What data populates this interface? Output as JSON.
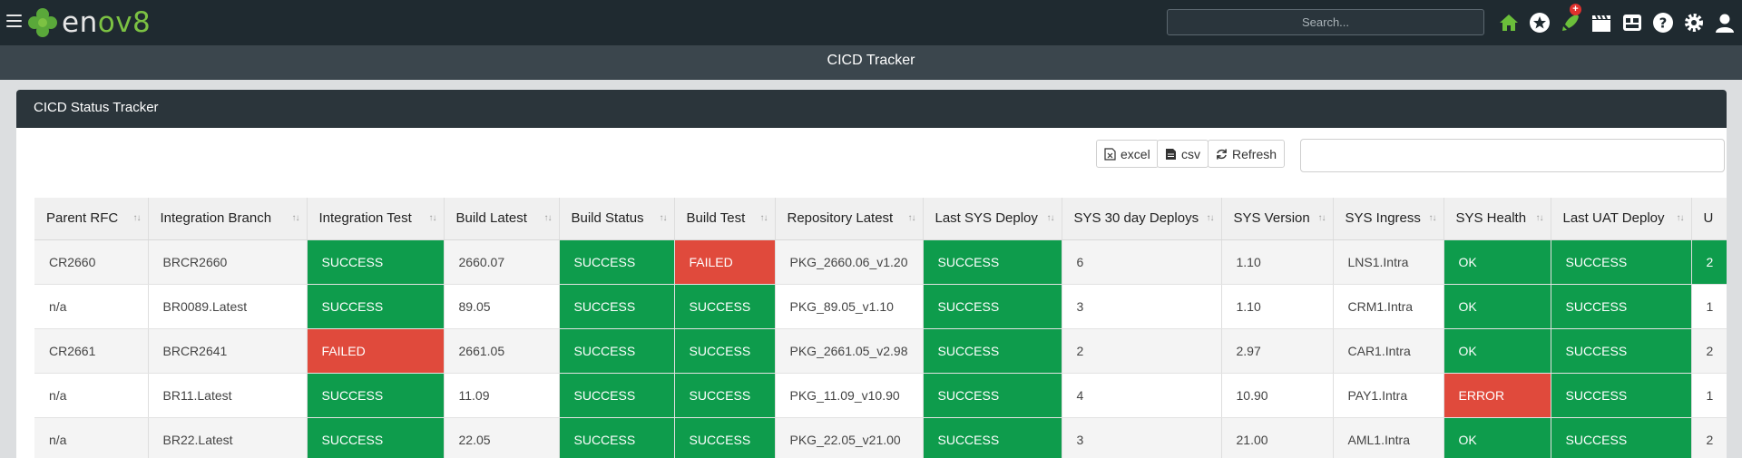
{
  "app": {
    "brand_prefix": "en",
    "brand_accent": "ov8"
  },
  "header": {
    "search_placeholder": "Search...",
    "badge_count": "+"
  },
  "page": {
    "title": "CICD Tracker"
  },
  "panel": {
    "title": "CICD Status Tracker"
  },
  "toolbar": {
    "excel_label": "excel",
    "csv_label": "csv",
    "refresh_label": "Refresh"
  },
  "colors": {
    "success": "#0e9c4c",
    "failed": "#e04a3c",
    "brand_green": "#7cc243",
    "topbar": "#1f2a30"
  },
  "table": {
    "columns": [
      "Parent RFC",
      "Integration Branch",
      "Integration Test",
      "Build Latest",
      "Build Status",
      "Build Test",
      "Repository Latest",
      "Last SYS Deploy",
      "SYS 30 day Deploys",
      "SYS Version",
      "SYS Ingress",
      "SYS Health",
      "Last UAT Deploy",
      "U"
    ],
    "rows": [
      [
        "CR2660",
        "BRCR2660",
        "SUCCESS",
        "2660.07",
        "SUCCESS",
        "FAILED",
        "PKG_2660.06_v1.20",
        "SUCCESS",
        "6",
        "1.10",
        "LNS1.Intra",
        "OK",
        "SUCCESS",
        "2"
      ],
      [
        "n/a",
        "BR0089.Latest",
        "SUCCESS",
        "89.05",
        "SUCCESS",
        "SUCCESS",
        "PKG_89.05_v1.10",
        "SUCCESS",
        "3",
        "1.10",
        "CRM1.Intra",
        "OK",
        "SUCCESS",
        "1"
      ],
      [
        "CR2661",
        "BRCR2641",
        "FAILED",
        "2661.05",
        "SUCCESS",
        "SUCCESS",
        "PKG_2661.05_v2.98",
        "SUCCESS",
        "2",
        "2.97",
        "CAR1.Intra",
        "OK",
        "SUCCESS",
        "2"
      ],
      [
        "n/a",
        "BR11.Latest",
        "SUCCESS",
        "11.09",
        "SUCCESS",
        "SUCCESS",
        "PKG_11.09_v10.90",
        "SUCCESS",
        "4",
        "10.90",
        "PAY1.Intra",
        "ERROR",
        "SUCCESS",
        "1"
      ],
      [
        "n/a",
        "BR22.Latest",
        "SUCCESS",
        "22.05",
        "SUCCESS",
        "SUCCESS",
        "PKG_22.05_v21.00",
        "SUCCESS",
        "3",
        "21.00",
        "AML1.Intra",
        "OK",
        "SUCCESS",
        "2"
      ]
    ]
  },
  "icons": [
    "home-icon",
    "star-icon",
    "rocket-icon",
    "clapperboard-icon",
    "dashboard-icon",
    "help-icon",
    "settings-icon",
    "user-icon"
  ]
}
